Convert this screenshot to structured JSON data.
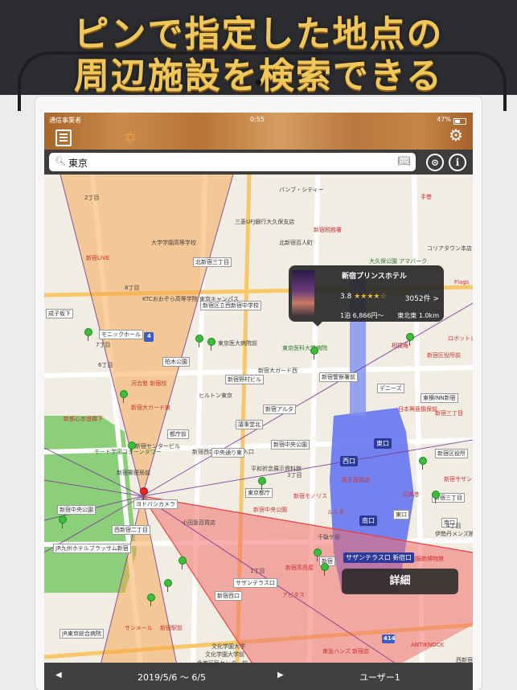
{
  "banner": {
    "line1": "ピンで指定した地点の",
    "line2": "周辺施設を検索できる"
  },
  "status": {
    "carrier": "通信事業者",
    "time": "0:55",
    "battery": "47%"
  },
  "toolbar": {
    "list_icon": "list-icon",
    "app_icon": "star-logo-icon",
    "settings_icon": "gears-icon"
  },
  "search": {
    "value": "東京",
    "compass_label": "⊙",
    "info_label": "i"
  },
  "map": {
    "labels": [
      {
        "t": "バンブ・シティー"
      },
      {
        "t": "三菱UFJ銀行大久保支店"
      },
      {
        "t": "北新宿百人町"
      },
      {
        "t": "新宿税務署"
      },
      {
        "t": "大久保公園 アマバーク"
      },
      {
        "t": "大学学園高等学校"
      },
      {
        "t": "北新宿三丁目"
      },
      {
        "t": "新宿LIVE"
      },
      {
        "t": "KTCおおぞら高等学院 東京キャンパス"
      },
      {
        "t": "新宿区立西新宿中学校"
      },
      {
        "t": "成子坂下"
      },
      {
        "t": "モニックホール"
      },
      {
        "t": "東京医大病院前"
      },
      {
        "t": "柏木公園"
      },
      {
        "t": "東京医科大学病院"
      },
      {
        "t": "河合塾 新宿校"
      },
      {
        "t": "新宿大ガード西"
      },
      {
        "t": "新宿警察署前"
      },
      {
        "t": "新宿野村ビル"
      },
      {
        "t": "ヒルトン東京"
      },
      {
        "t": "新宿大ガード東"
      },
      {
        "t": "デニーズ"
      },
      {
        "t": "新都心歩道橋下"
      },
      {
        "t": "新宿アルタ"
      },
      {
        "t": "日本興亜損保前"
      },
      {
        "t": "議事堂北"
      },
      {
        "t": "都庁前"
      },
      {
        "t": "新宿センタービル"
      },
      {
        "t": "新宿西口ロータリー入口"
      },
      {
        "t": "新宿中央公園"
      },
      {
        "t": "モード学園コクーンタワー"
      },
      {
        "t": "平和祈念展示資料館"
      },
      {
        "t": "新宿郵便局前"
      },
      {
        "t": "東京都庁"
      },
      {
        "t": "ヨドバシカメラ"
      },
      {
        "t": "新宿モノリス"
      },
      {
        "t": "小田急百貨店"
      },
      {
        "t": "京王百貨店"
      },
      {
        "t": "ルミネ"
      },
      {
        "t": "新宿中央公園"
      },
      {
        "t": "西新宿二丁目"
      },
      {
        "t": "JR九州ホテルブラッサム新宿"
      },
      {
        "t": "サザンテラス口"
      },
      {
        "t": "新宿高島屋"
      },
      {
        "t": "アピタス"
      },
      {
        "t": "文化学園服飾博物館"
      },
      {
        "t": "文化学園大学"
      },
      {
        "t": "角筈区民センター前"
      },
      {
        "t": "JR東京総合病院"
      },
      {
        "t": "東急ハンズ 新宿店"
      },
      {
        "t": "ANTIKNOCK"
      },
      {
        "t": "伊勢丹メンズ館"
      },
      {
        "t": "新宿三丁目"
      },
      {
        "t": "新宿区役所"
      },
      {
        "t": "ロボットレストラン"
      },
      {
        "t": "相撲庵"
      },
      {
        "t": "新宿区役所前"
      },
      {
        "t": "東横INN新宿"
      },
      {
        "t": "コリアタウン本店"
      },
      {
        "t": "手巻"
      },
      {
        "t": "Flags"
      },
      {
        "t": "沼津港"
      },
      {
        "t": "新宿サザンタワー"
      },
      {
        "t": "千駄ケ谷"
      },
      {
        "t": "西新宿"
      },
      {
        "t": "新宿西口"
      },
      {
        "t": "新宿"
      },
      {
        "t": "南口"
      },
      {
        "t": "東口"
      },
      {
        "t": "新宿三丁目"
      },
      {
        "t": "中央通り東"
      },
      {
        "t": "新宿中央公園"
      },
      {
        "t": "文化学園大学前"
      },
      {
        "t": "サンメール"
      },
      {
        "t": "新宿駅前"
      },
      {
        "t": "8丁目"
      },
      {
        "t": "7丁目"
      },
      {
        "t": "6丁目"
      },
      {
        "t": "4丁目"
      },
      {
        "t": "3丁目"
      },
      {
        "t": "2丁目"
      },
      {
        "t": "1丁目"
      }
    ],
    "stations": [
      "西口",
      "南口",
      "新宿口",
      "東口",
      "サザンテラス口"
    ],
    "route_number": "4",
    "route_number2": "414"
  },
  "popup": {
    "name": "新宿プリンスホテル",
    "rating": "3.8",
    "stars": "★★★★☆",
    "count": "3052件 >",
    "price": "1泊 6,866円〜",
    "distance": "東北東 1.0km"
  },
  "detail_button": "詳細",
  "bottom": {
    "prev": "◀",
    "date_range": "2019/5/6 〜 6/5",
    "next": "▶",
    "user": "ユーザー1"
  },
  "colors": {
    "banner_text": "#f0c75a",
    "wood": "#b9783e",
    "sector_orange": "#f7a34a",
    "sector_red": "#f0706a",
    "station_blue": "#5d6ff0"
  }
}
